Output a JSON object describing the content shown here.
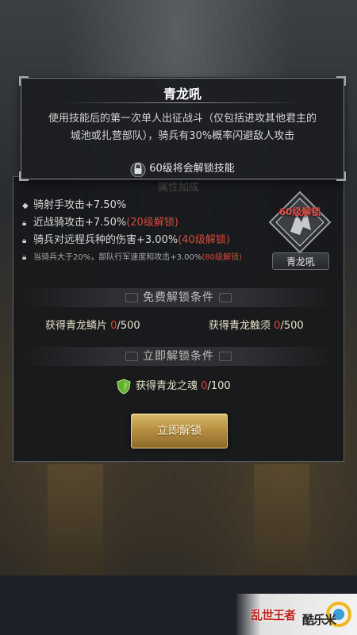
{
  "tooltip": {
    "title": "青龙吼",
    "desc_line1": "使用技能后的第一次单人出征战斗（仅包括进攻其他君主的",
    "desc_line2": "城池或扎营部队），骑兵有30%概率闪避敌人攻击",
    "lock_text": "60级将会解锁技能"
  },
  "attributes": [
    {
      "text": "骑射手攻击+7.50%",
      "req": "",
      "locked": false
    },
    {
      "text": "近战骑攻击+7.50%",
      "req": "(20级解锁)",
      "locked": true
    },
    {
      "text": "骑兵对远程兵种的伤害+3.00%",
      "req": "(40级解锁)",
      "locked": true
    },
    {
      "text": "当骑兵大于20%，部队行军速度和攻击+3.00%",
      "req": "(80级解锁)",
      "locked": true
    }
  ],
  "skill": {
    "badge_label": "60级解锁",
    "button_label": "青龙吼"
  },
  "free_unlock": {
    "header": "免费解锁条件",
    "items": [
      {
        "label": "获得青龙鳞片",
        "current": "0",
        "total": "/500"
      },
      {
        "label": "获得青龙触须",
        "current": "0",
        "total": "/500"
      }
    ]
  },
  "instant_unlock": {
    "header": "立即解锁条件",
    "item": {
      "label": "获得青龙之魂",
      "current": "0",
      "total": "/100"
    }
  },
  "unlock_button": "立即解锁",
  "branding": {
    "game_logo": "乱世王者",
    "site_logo": "酷乐米"
  },
  "colors": {
    "required_red": "#d44a3a",
    "gold_button": "#b99042",
    "panel_bg": "#16181c"
  }
}
